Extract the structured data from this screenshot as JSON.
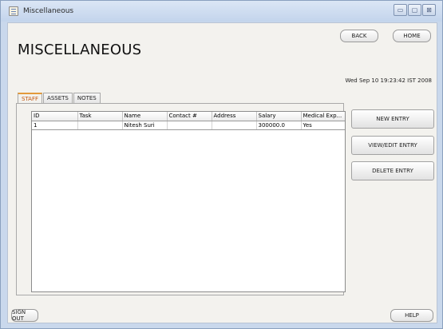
{
  "window": {
    "title": "Miscellaneous",
    "controls": {
      "minimize": "▭",
      "maximize": "▢",
      "close": "⊠"
    }
  },
  "header": {
    "page_title": "MISCELLANEOUS",
    "back_label": "BACK",
    "home_label": "HOME",
    "datetime": "Wed Sep 10 19:23:42 IST 2008"
  },
  "tabs": [
    {
      "label": "STAFF",
      "active": true
    },
    {
      "label": "ASSETS",
      "active": false
    },
    {
      "label": "NOTES",
      "active": false
    }
  ],
  "table": {
    "columns": [
      "ID",
      "Task",
      "Name",
      "Contact #",
      "Address",
      "Salary",
      "Medical Exp..."
    ],
    "rows": [
      [
        "1",
        "",
        "Nitesh Suri",
        "",
        "",
        "300000.0",
        "Yes"
      ]
    ]
  },
  "actions": {
    "new_entry": "NEW ENTRY",
    "view_edit_entry": "VIEW/EDIT ENTRY",
    "delete_entry": "DELETE ENTRY"
  },
  "footer": {
    "sign_out": "SIGN OUT",
    "help": "HELP"
  },
  "colors": {
    "active_tab_text": "#c2560e",
    "active_tab_accent": "#e39a3b",
    "panel_background": "#f3f2ee"
  }
}
